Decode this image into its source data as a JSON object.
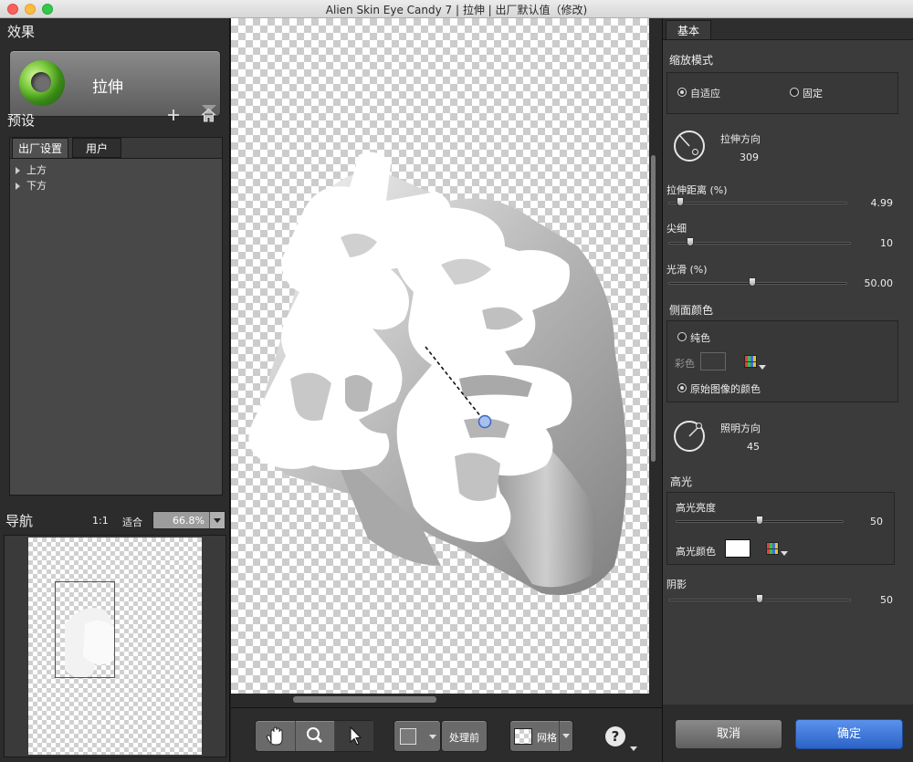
{
  "window": {
    "title": "Alien Skin Eye Candy 7 | 拉伸 | 出厂默认值（修改)"
  },
  "left": {
    "effect_heading": "效果",
    "effect_name": "拉伸",
    "presets_heading": "预设",
    "add_icon": "plus-icon",
    "home_icon": "home-icon",
    "tabs": [
      "出厂设置",
      "用户"
    ],
    "tree": [
      "上方",
      "下方"
    ],
    "nav_heading": "导航",
    "nav_ratio": "1:1",
    "nav_fit": "适合",
    "zoom_value": "66.8%"
  },
  "toolbar": {
    "before_label": "处理前",
    "grid_label": "网格",
    "help_icon": "help-icon"
  },
  "right": {
    "tab": "基本",
    "scale_mode": {
      "label": "缩放模式",
      "options": [
        "自适应",
        "固定"
      ],
      "selected": "自适应"
    },
    "stretch_direction": {
      "label": "拉伸方向",
      "value": "309"
    },
    "stretch_distance": {
      "label": "拉伸距离 (%)",
      "value": "4.99",
      "slider_fraction": 0.03
    },
    "taper": {
      "label": "尖细",
      "value": "10",
      "slider_fraction": 0.1
    },
    "smooth": {
      "label": "光滑 (%)",
      "value": "50.00",
      "slider_fraction": 0.5
    },
    "side_color": {
      "label": "侧面颜色",
      "options": [
        "纯色",
        "原始图像的颜色"
      ],
      "selected": "原始图像的颜色",
      "color_label": "彩色",
      "color": "#3a3a3a"
    },
    "light_direction": {
      "label": "照明方向",
      "value": "45"
    },
    "highlight": {
      "label": "高光",
      "brightness_label": "高光亮度",
      "brightness_value": "50",
      "brightness_fraction": 0.5,
      "color_label": "高光颜色",
      "color": "#ffffff"
    },
    "shadow": {
      "label": "阴影",
      "value": "50",
      "slider_fraction": 0.5
    },
    "cancel_label": "取消",
    "ok_label": "确定"
  },
  "colors": {
    "accent": "#3a73d6",
    "ok_button": "#3a73d6",
    "cancel_button": "#6a6a6a"
  }
}
